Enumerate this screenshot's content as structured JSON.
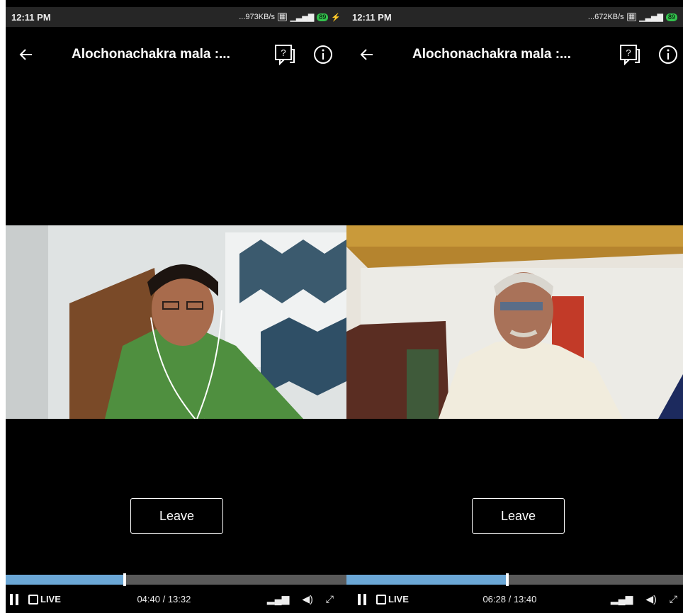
{
  "panels": [
    {
      "status": {
        "time": "12:11 PM",
        "net_speed": "...973KB/s",
        "battery": "89"
      },
      "title": "Alochonachakra mala :...",
      "leave_label": "Leave",
      "playback": {
        "position": "04:40",
        "duration": "13:32",
        "time_label": "04:40 / 13:32",
        "progress": 0.345
      },
      "live_label": "LIVE"
    },
    {
      "status": {
        "time": "12:11 PM",
        "net_speed": "...672KB/s",
        "battery": "89"
      },
      "title": "Alochonachakra mala :...",
      "leave_label": "Leave",
      "playback": {
        "position": "06:28",
        "duration": "13:40",
        "time_label": "06:28 / 13:40",
        "progress": 0.473
      },
      "live_label": "LIVE"
    }
  ],
  "icons": [
    "back-arrow-icon",
    "question-chat-icon",
    "info-icon",
    "pause-icon",
    "signal-icon",
    "volume-icon",
    "expand-icon"
  ],
  "colors": {
    "progress_fill": "#6ba7d6",
    "progress_track": "#5a5a5a",
    "background": "#000000"
  }
}
